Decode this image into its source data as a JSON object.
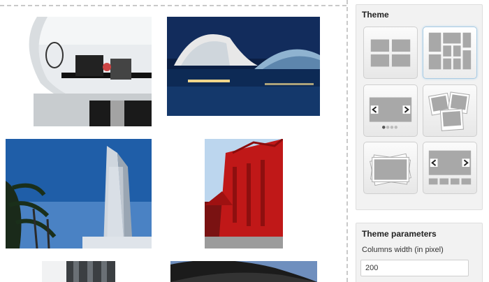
{
  "theme_panel": {
    "title": "Theme",
    "options": [
      {
        "icon": "grid-layout-icon",
        "selected": false
      },
      {
        "icon": "masonry-layout-icon",
        "selected": true
      },
      {
        "icon": "slider-layout-icon",
        "selected": false
      },
      {
        "icon": "stacked-polaroids-icon",
        "selected": false
      },
      {
        "icon": "photo-stack-icon",
        "selected": false
      },
      {
        "icon": "carousel-thumbnails-icon",
        "selected": false
      }
    ]
  },
  "params_panel": {
    "title": "Theme parameters",
    "columns_width_label": "Columns width (in pixel)",
    "columns_width_value": "200"
  },
  "gallery": {
    "images": [
      {
        "subject": "modern white interior"
      },
      {
        "subject": "futuristic building at night"
      },
      {
        "subject": "twin skyscraper with palms"
      },
      {
        "subject": "red heritage building"
      },
      {
        "subject": "glass facade tower"
      },
      {
        "subject": "curved dark roof building"
      }
    ]
  },
  "colors": {
    "accent_border": "#a9cbe3",
    "panel_bg": "#f2f2f2"
  }
}
